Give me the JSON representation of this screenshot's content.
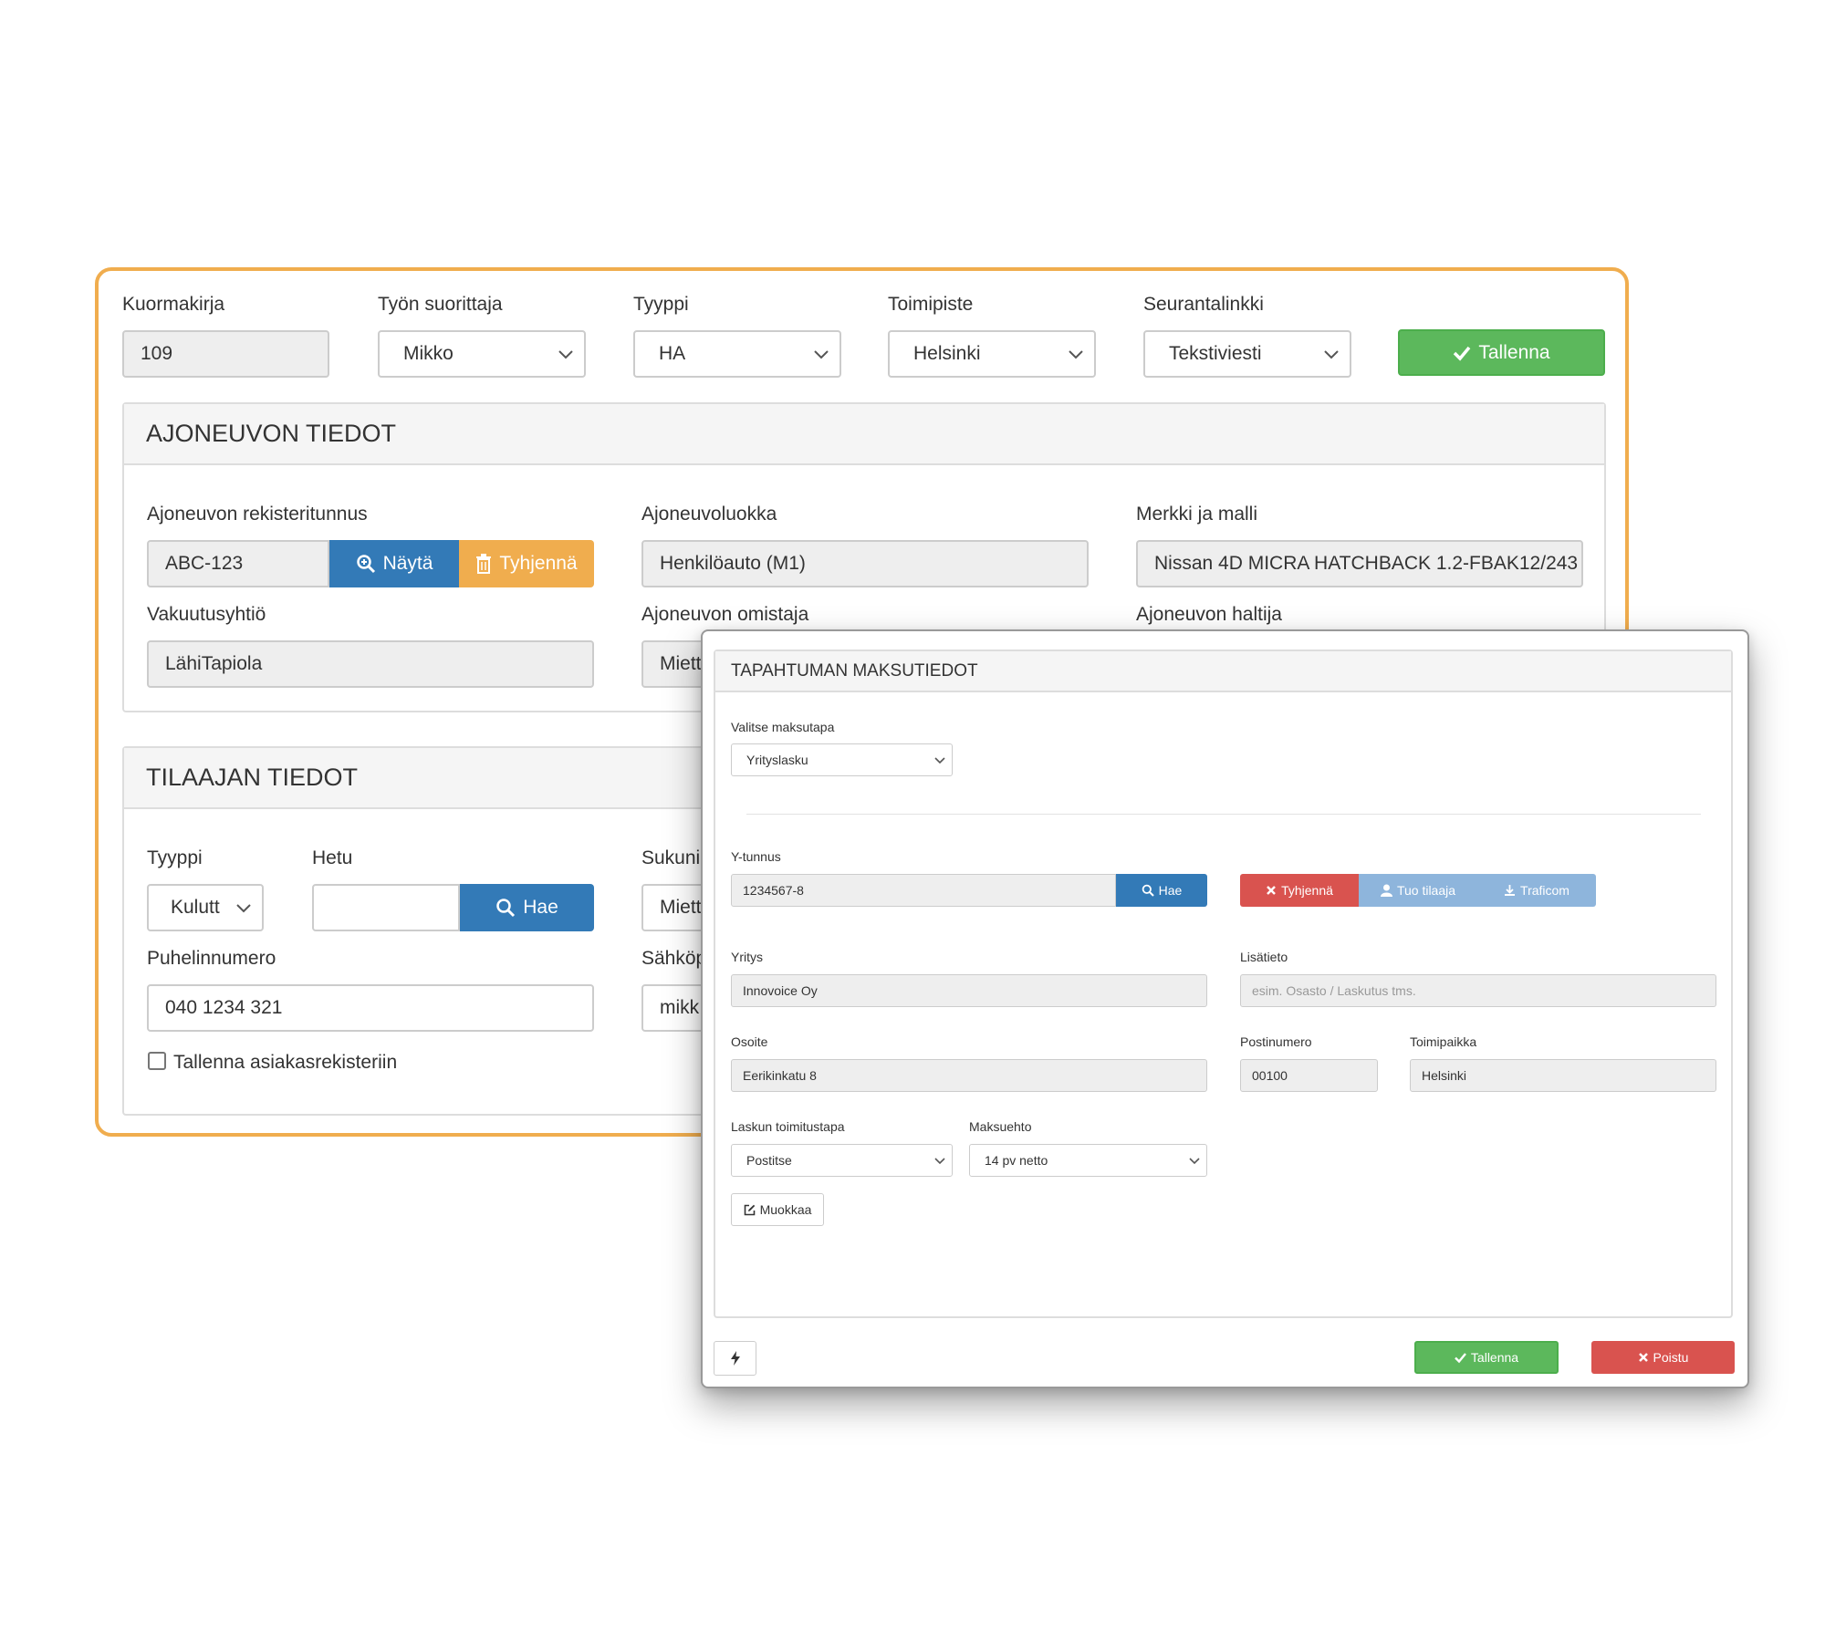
{
  "header": {
    "kuormakirja_label": "Kuormakirja",
    "kuormakirja_value": "109",
    "suorittaja_label": "Työn suorittaja",
    "suorittaja_value": "Mikko",
    "tyyppi_label": "Tyyppi",
    "tyyppi_value": "HA",
    "toimipiste_label": "Toimipiste",
    "toimipiste_value": "Helsinki",
    "seuranta_label": "Seurantalinkki",
    "seuranta_value": "Tekstiviesti",
    "save_label": "Tallenna"
  },
  "vehicle": {
    "title": "AJONEUVON TIEDOT",
    "reg_label": "Ajoneuvon rekisteritunnus",
    "reg_value": "ABC-123",
    "show_label": "Näytä",
    "clear_label": "Tyhjennä",
    "class_label": "Ajoneuvoluokka",
    "class_value": "Henkilöauto (M1)",
    "make_label": "Merkki ja malli",
    "make_value": "Nissan 4D MICRA HATCHBACK 1.2-FBAK12/243",
    "insurance_label": "Vakuutusyhtiö",
    "insurance_value": "LähiTapiola",
    "owner_label": "Ajoneuvon omistaja",
    "owner_value": "Miett",
    "holder_label": "Ajoneuvon haltija"
  },
  "customer": {
    "title": "TILAAJAN TIEDOT",
    "type_label": "Tyyppi",
    "type_value": "Kulutt",
    "hetu_label": "Hetu",
    "hetu_value": "",
    "search_label": "Hae",
    "surname_label": "Sukuni",
    "surname_value": "Miett",
    "phone_label": "Puhelinnumero",
    "phone_value": "040 1234 321",
    "email_label": "Sähköp",
    "email_value": "mikk",
    "save_register_label": "Tallenna asiakasrekisteriin"
  },
  "modal": {
    "title": "TAPAHTUMAN MAKSUTIEDOT",
    "payment_label": "Valitse maksutapa",
    "payment_value": "Yrityslasku",
    "ytunnus_label": "Y-tunnus",
    "ytunnus_value": "1234567-8",
    "search_label": "Hae",
    "clear_label": "Tyhjennä",
    "import_label": "Tuo tilaaja",
    "traficom_label": "Traficom",
    "company_label": "Yritys",
    "company_value": "Innovoice Oy",
    "extra_label": "Lisätieto",
    "extra_placeholder": "esim. Osasto / Laskutus tms.",
    "address_label": "Osoite",
    "address_value": "Eerikinkatu 8",
    "postal_label": "Postinumero",
    "postal_value": "00100",
    "city_label": "Toimipaikka",
    "city_value": "Helsinki",
    "delivery_label": "Laskun toimitustapa",
    "delivery_value": "Postitse",
    "terms_label": "Maksuehto",
    "terms_value": "14 pv netto",
    "edit_label": "Muokkaa",
    "save_label": "Tallenna",
    "exit_label": "Poistu"
  },
  "colors": {
    "accent_border": "#f0ad4e",
    "success": "#5cb85c",
    "primary": "#337ab7",
    "warning": "#f0ad4e",
    "danger": "#d9534f"
  }
}
